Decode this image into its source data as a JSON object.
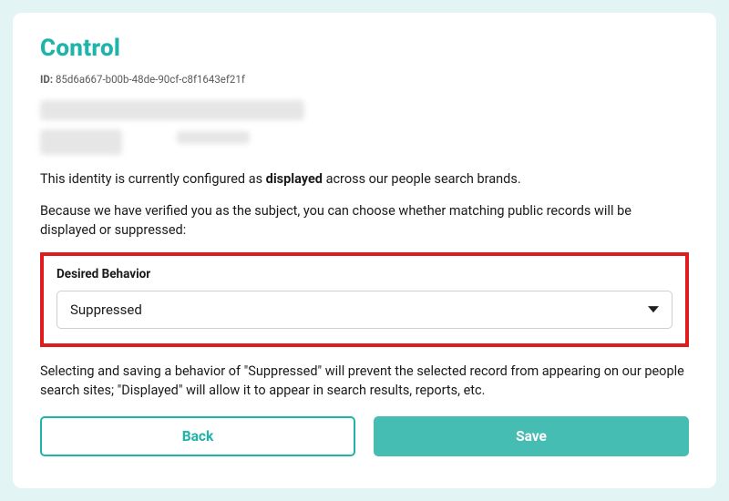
{
  "page": {
    "title": "Control",
    "id_label": "ID:",
    "id_value": "85d6a667-b00b-48de-90cf-c8f1643ef21f"
  },
  "status_text": {
    "prefix": "This identity is currently configured as ",
    "bold": "displayed",
    "suffix": " across our people search brands."
  },
  "instruction_text": "Because we have verified you as the subject, you can choose whether matching public records will be displayed or suppressed:",
  "behavior": {
    "label": "Desired Behavior",
    "selected": "Suppressed"
  },
  "help_text": "Selecting and saving a behavior of \"Suppressed\" will prevent the selected record from appearing on our people search sites; \"Displayed\" will allow it to appear in search results, reports, etc.",
  "buttons": {
    "back": "Back",
    "save": "Save"
  }
}
